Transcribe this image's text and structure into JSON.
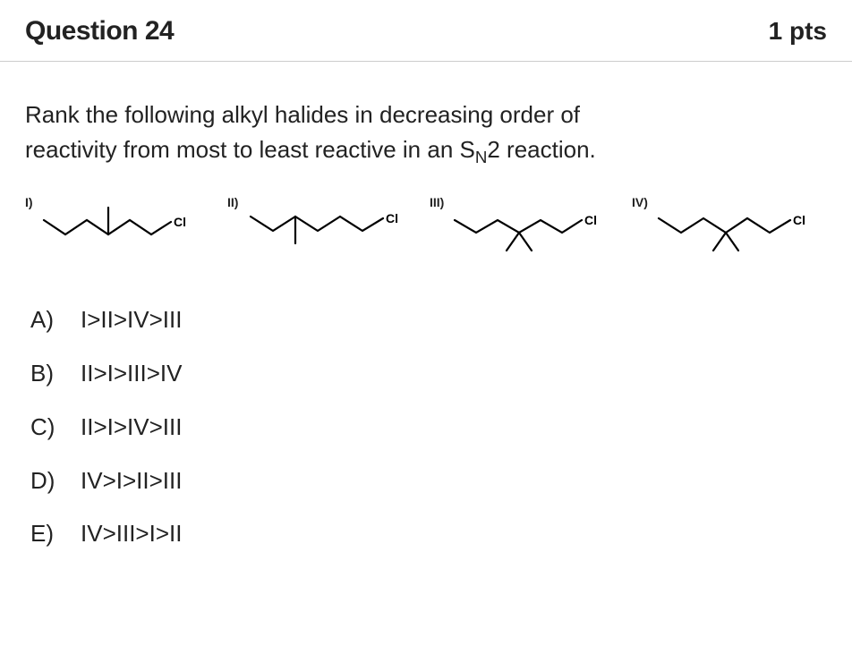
{
  "header": {
    "title": "Question 24",
    "points": "1 pts"
  },
  "prompt": {
    "line1": "Rank the following alkyl halides in decreasing order of",
    "line2_a": "reactivity from most to least reactive in an S",
    "line2_sub": "N",
    "line2_b": "2 reaction."
  },
  "structures": {
    "s1": {
      "label": "I)",
      "atom": "Cl"
    },
    "s2": {
      "label": "II)",
      "atom": "Cl"
    },
    "s3": {
      "label": "III)",
      "atom": "Cl"
    },
    "s4": {
      "label": "IV)",
      "atom": "Cl"
    }
  },
  "options": {
    "a": {
      "label": "A)",
      "text": "I>II>IV>III"
    },
    "b": {
      "label": "B)",
      "text": "II>I>III>IV"
    },
    "c": {
      "label": "C)",
      "text": "II>I>IV>III"
    },
    "d": {
      "label": "D)",
      "text": "IV>I>II>III"
    },
    "e": {
      "label": "E)",
      "text": "IV>III>I>II"
    }
  }
}
